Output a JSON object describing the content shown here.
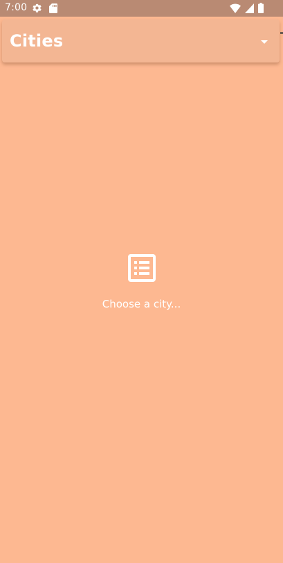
{
  "status_bar": {
    "time": "7:00",
    "left_icons": [
      "gear-icon",
      "sd-card-icon"
    ],
    "right_icons": [
      "wifi-icon",
      "signal-icon",
      "battery-icon"
    ]
  },
  "app_bar": {
    "title": "Cities",
    "dropdown_icon": "arrow-drop-down-icon"
  },
  "empty_state": {
    "icon": "list-alt-icon",
    "label": "Choose a city..."
  },
  "colors": {
    "background": "#fdb891",
    "app_bar": "#f3b693",
    "status_bar": "#b98a73",
    "text": "#ffffff"
  }
}
